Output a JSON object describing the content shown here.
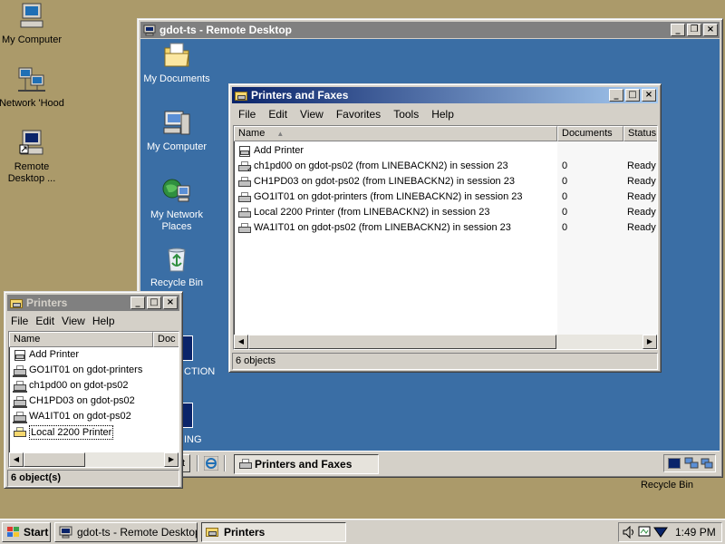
{
  "desktop": {
    "outer_icons": [
      {
        "name": "my-computer",
        "label": "My Computer"
      },
      {
        "name": "network-hood",
        "label": "Network 'Hood"
      },
      {
        "name": "remote-desktop",
        "label": "Remote Desktop ..."
      },
      {
        "name": "recycle-bin",
        "label": "Recycle Bin"
      }
    ]
  },
  "remote_desktop": {
    "title": "gdot-ts - Remote Desktop",
    "icons": [
      {
        "name": "my-documents",
        "label": "My Documents"
      },
      {
        "name": "my-computer",
        "label": "My Computer"
      },
      {
        "name": "my-network-places",
        "label": "My Network Places"
      },
      {
        "name": "recycle-bin",
        "label": "Recycle Bin"
      }
    ],
    "partial_labels": [
      "CTION",
      "ING"
    ],
    "taskbar_button": "Printers and Faxes"
  },
  "printers_and_faxes": {
    "title": "Printers and Faxes",
    "menu": [
      "File",
      "Edit",
      "View",
      "Favorites",
      "Tools",
      "Help"
    ],
    "columns": [
      "Name",
      "Documents",
      "Status"
    ],
    "rows": [
      {
        "name": "Add Printer",
        "documents": "",
        "status": ""
      },
      {
        "name": "ch1pd00 on gdot-ps02 (from LINEBACKN2) in session 23",
        "documents": "0",
        "status": "Ready"
      },
      {
        "name": "CH1PD03 on gdot-ps02 (from LINEBACKN2) in session 23",
        "documents": "0",
        "status": "Ready"
      },
      {
        "name": "GO1IT01 on gdot-printers (from LINEBACKN2) in session 23",
        "documents": "0",
        "status": "Ready"
      },
      {
        "name": "Local 2200 Printer (from LINEBACKN2) in session 23",
        "documents": "0",
        "status": "Ready"
      },
      {
        "name": "WA1IT01 on gdot-ps02 (from LINEBACKN2) in session 23",
        "documents": "0",
        "status": "Ready"
      }
    ],
    "status": "6 objects"
  },
  "printers": {
    "title": "Printers",
    "menu": [
      "File",
      "Edit",
      "View",
      "Help"
    ],
    "columns": [
      "Name",
      "Doc"
    ],
    "rows": [
      "Add Printer",
      "GO1IT01 on gdot-printers",
      "ch1pd00 on gdot-ps02",
      "CH1PD03 on gdot-ps02",
      "WA1IT01 on gdot-ps02",
      "Local 2200 Printer"
    ],
    "status": "6 object(s)"
  },
  "taskbar": {
    "start": "Start",
    "buttons": [
      "gdot-ts - Remote Desktop",
      "Printers"
    ],
    "clock": "1:49 PM"
  }
}
